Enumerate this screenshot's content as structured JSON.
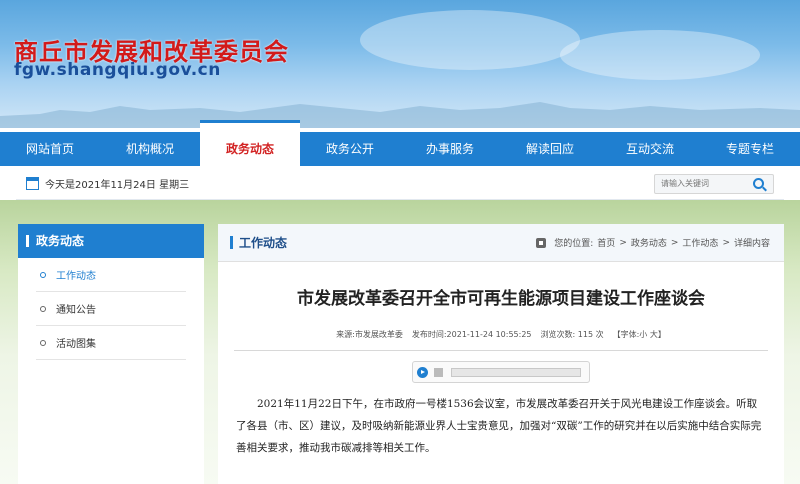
{
  "header": {
    "site_title": "商丘市发展和改革委员会",
    "site_url": "fgw.shangqiu.gov.cn"
  },
  "nav": {
    "items": [
      {
        "label": "网站首页"
      },
      {
        "label": "机构概况"
      },
      {
        "label": "政务动态"
      },
      {
        "label": "政务公开"
      },
      {
        "label": "办事服务"
      },
      {
        "label": "解读回应"
      },
      {
        "label": "互动交流"
      },
      {
        "label": "专题专栏"
      }
    ],
    "active_index": 2
  },
  "datebar": {
    "date_text": "今天是2021年11月24日 星期三",
    "search_placeholder": "请输入关键词"
  },
  "sidebar": {
    "title": "政务动态",
    "items": [
      {
        "label": "工作动态"
      },
      {
        "label": "通知公告"
      },
      {
        "label": "活动图集"
      }
    ]
  },
  "main": {
    "section_title": "工作动态",
    "breadcrumb": {
      "prefix": "您的位置:",
      "home": "首页",
      "sep": ">",
      "level1": "政务动态",
      "level2": "工作动态",
      "level3": "详细内容"
    },
    "article": {
      "title": "市发展改革委召开全市可再生能源项目建设工作座谈会",
      "source_label": "来源:",
      "source": "市发展改革委",
      "time_label": "发布时间:",
      "time": "2021-11-24 10:55:25",
      "views_label": "浏览次数:",
      "views": "115",
      "views_unit": "次",
      "font_label": "【字体:",
      "font_small": "小",
      "font_big": "大】",
      "body": "2021年11月22日下午，在市政府一号楼1536会议室，市发展改革委召开关于风光电建设工作座谈会。听取了各县（市、区）建议，及时吸纳新能源业界人士宝贵意见，加强对“双碳”工作的研究并在以后实施中结合实际完善相关要求，推动我市碳减排等相关工作。"
    },
    "audio_progress": 0
  },
  "colors": {
    "primary": "#1f7fd0",
    "title_red": "#d21a1a",
    "url_blue": "#1a4f9a"
  }
}
